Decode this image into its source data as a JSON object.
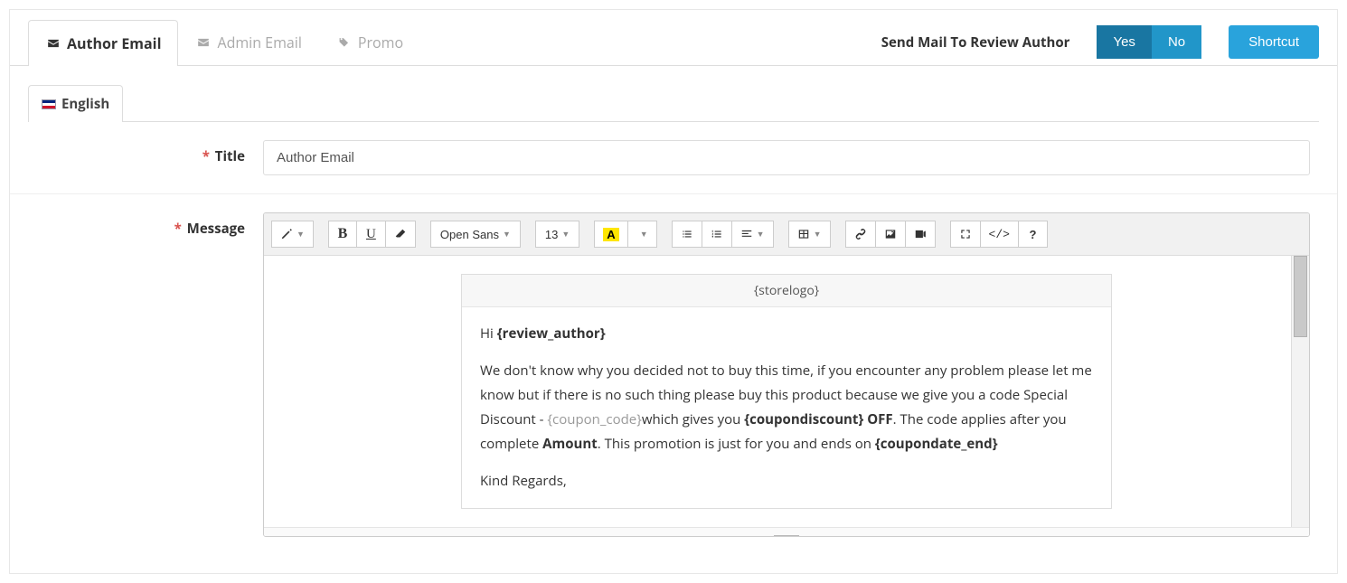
{
  "tabs": {
    "author": "Author Email",
    "admin": "Admin Email",
    "promo": "Promo"
  },
  "send_label": "Send Mail To Review Author",
  "toggle": {
    "yes": "Yes",
    "no": "No"
  },
  "shortcut": "Shortcut",
  "language_tab": "English",
  "fields": {
    "title_label": "Title",
    "title_value": "Author Email",
    "message_label": "Message"
  },
  "toolbar": {
    "font_family": "Open Sans",
    "font_size": "13"
  },
  "editor": {
    "logo_row": "{storelogo}",
    "greeting_prefix": "Hi ",
    "greeting_var": "{review_author}",
    "p1_a": "We don't know why you decided not to buy this time, if you encounter any problem please let me know but if there is no such thing please buy this product because we give you a code Special Discount -  ",
    "coupon_code": "{coupon_code}",
    "p1_b": "which gives you ",
    "discount_var": "{coupondiscount} OFF",
    "p1_c": ". The code applies after you complete ",
    "amount": "Amount",
    "p1_d": ". This promotion is just for you and ends on ",
    "date_var": "{coupondate_end}",
    "signoff": "Kind Regards,"
  }
}
